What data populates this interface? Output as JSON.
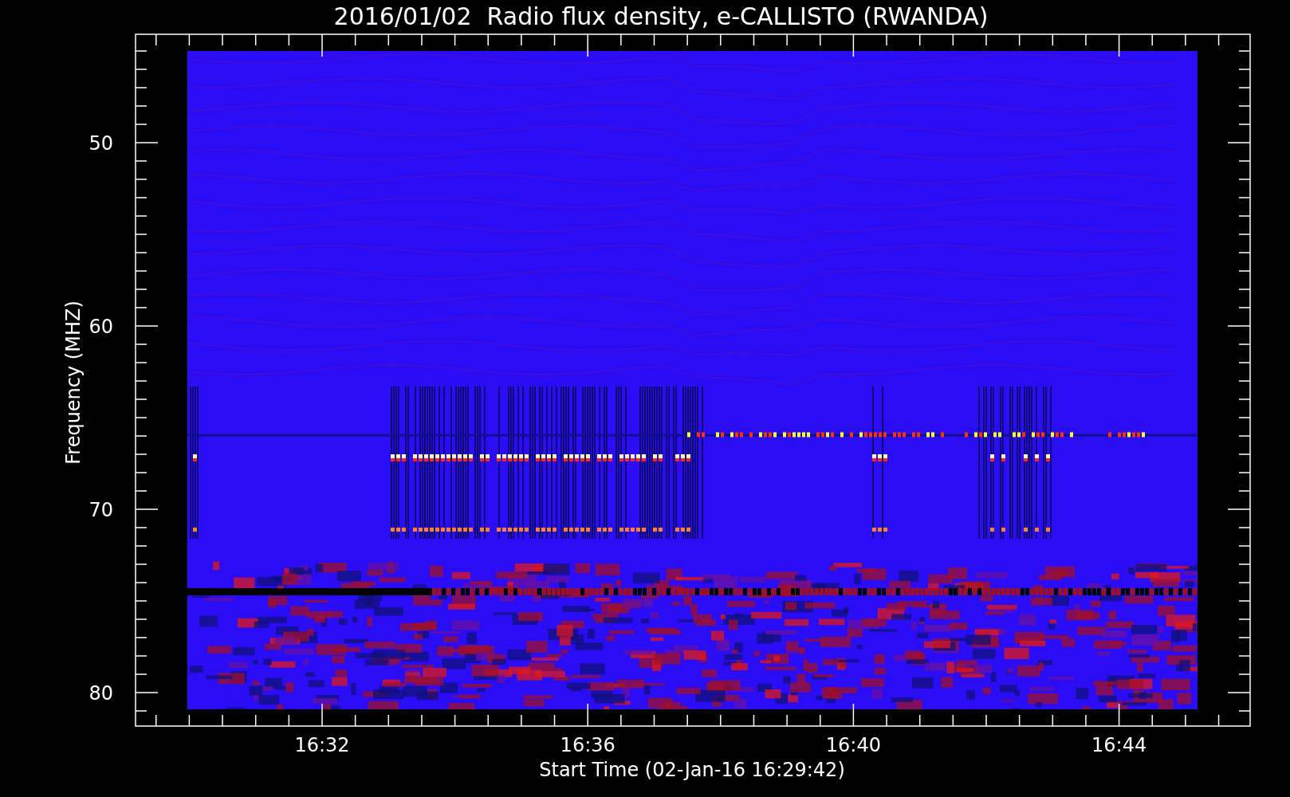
{
  "title": "2016/01/02  Radio flux density, e-CALLISTO (RWANDA)",
  "y_axis": {
    "label": "Frequency (MHZ)",
    "ticks": [
      "50",
      "60",
      "70",
      "80"
    ]
  },
  "x_axis": {
    "label": "Start Time (02-Jan-16 16:29:42)",
    "ticks": [
      "16:32",
      "16:36",
      "16:40",
      "16:44"
    ]
  }
}
